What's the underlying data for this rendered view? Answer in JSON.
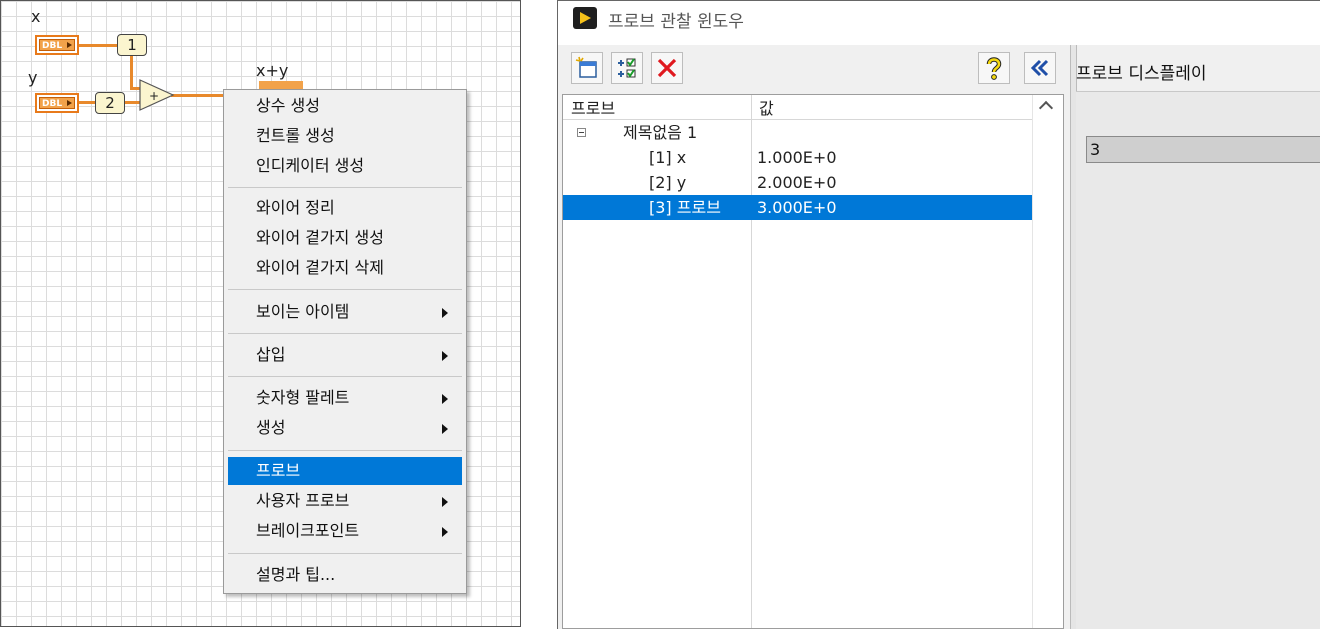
{
  "diagram": {
    "x_label": "x",
    "y_label": "y",
    "sum_label": "x+y",
    "dbl_text": "DBL",
    "const1": "1",
    "const2": "2",
    "add_symbol": "+"
  },
  "context_menu": {
    "items": [
      {
        "label": "상수 생성"
      },
      {
        "label": "컨트롤 생성"
      },
      {
        "label": "인디케이터 생성"
      },
      {
        "label": "와이어 정리"
      },
      {
        "label": "와이어 곁가지 생성"
      },
      {
        "label": "와이어 곁가지 삭제"
      },
      {
        "label": "보이는 아이템",
        "submenu": true
      },
      {
        "label": "삽입",
        "submenu": true
      },
      {
        "label": "숫자형 팔레트",
        "submenu": true
      },
      {
        "label": "생성",
        "submenu": true
      },
      {
        "label": "프로브",
        "selected": true
      },
      {
        "label": "사용자 프로브",
        "submenu": true
      },
      {
        "label": "브레이크포인트",
        "submenu": true
      },
      {
        "label": "설명과 팁..."
      }
    ]
  },
  "probe_window": {
    "title": "프로브 관찰 윈도우",
    "toolbar": {
      "new_probe_icon": "new-window-icon",
      "checklist_icon": "checklist-icon",
      "delete_icon": "delete-x-icon",
      "help_icon": "help-question-icon",
      "collapse_icon": "double-chevron-left-icon"
    },
    "columns": [
      "프로브",
      "값"
    ],
    "group": "제목없음 1",
    "rows": [
      {
        "name": "[1] x",
        "value": "1.000E+0"
      },
      {
        "name": "[2] y",
        "value": "2.000E+0"
      },
      {
        "name": "[3] 프로브",
        "value": "3.000E+0",
        "selected": true
      }
    ],
    "display_title": "프로브 디스플레이",
    "display_value": "3"
  },
  "colors": {
    "wire": "#e8892b",
    "selection": "#0078d7",
    "constant_bg": "#fbf5cf",
    "accent_delete": "#e0191f"
  }
}
